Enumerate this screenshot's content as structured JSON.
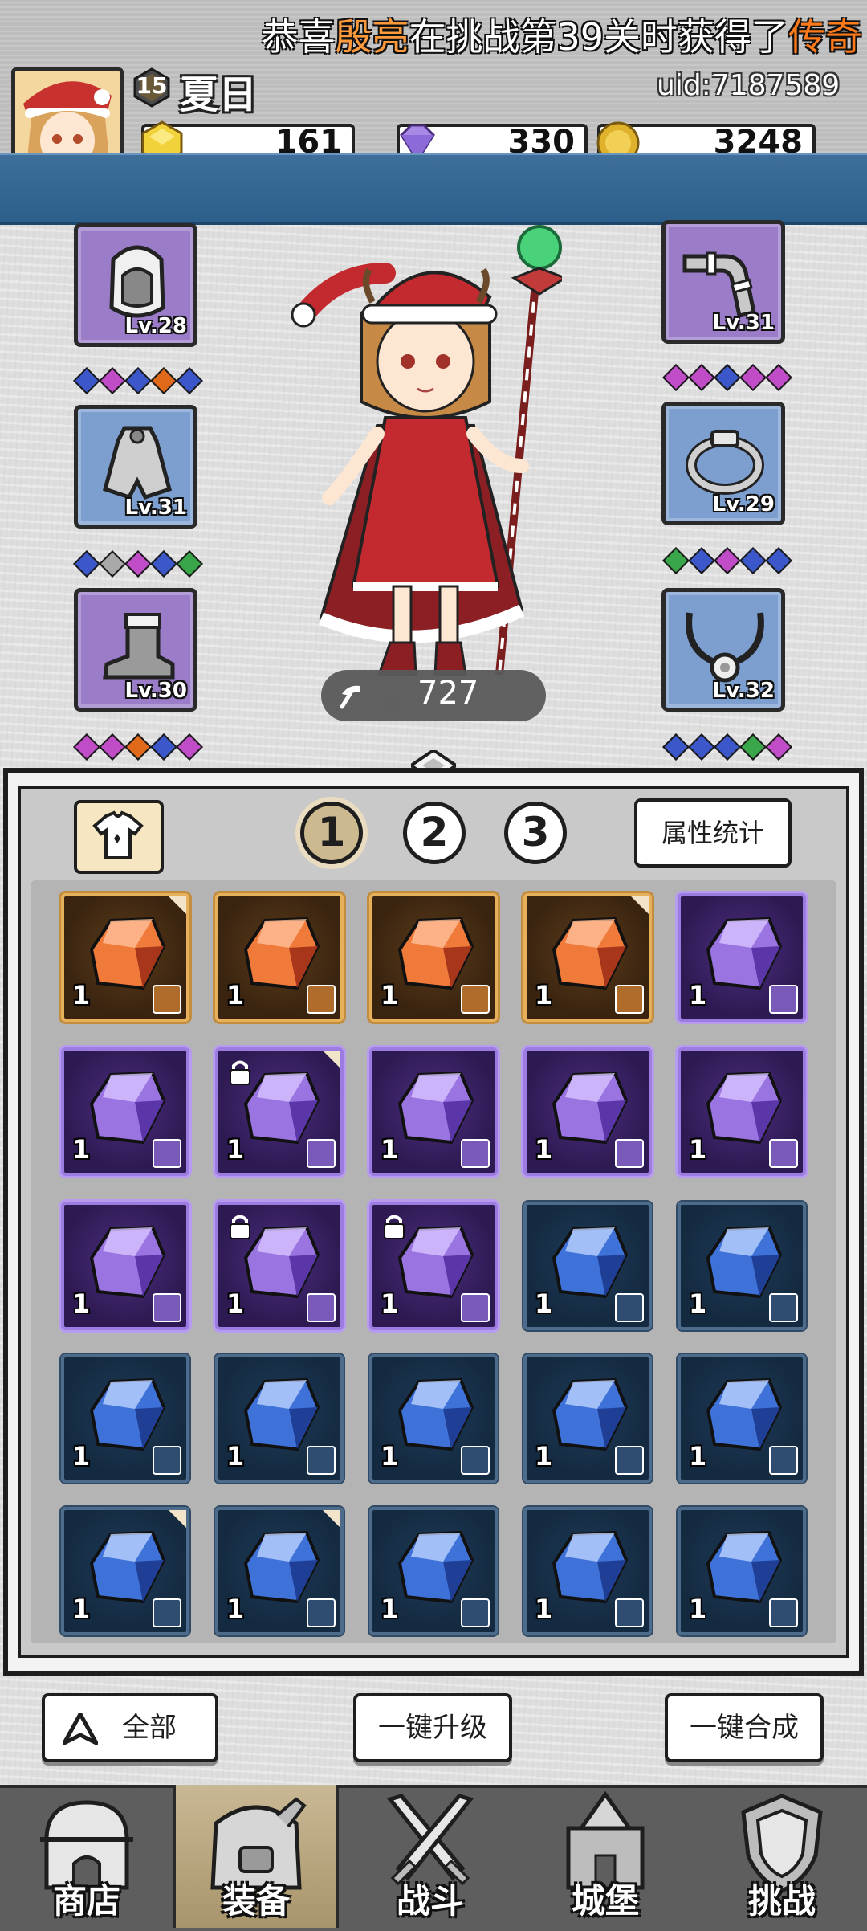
{
  "player": {
    "name": "夏日",
    "level": "15",
    "uid": "uid:7187589"
  },
  "resources": [
    {
      "name": "gold-gem",
      "value": "161",
      "color": "#f2d23a"
    },
    {
      "name": "purple-diamond",
      "value": "330",
      "color": "#a88ae6"
    },
    {
      "name": "gold-coin",
      "value": "3248",
      "color": "#e0b12a"
    }
  ],
  "announcement": {
    "prefix": "恭喜",
    "player": "殷亮",
    "middle": "在挑战第39关时获得了",
    "rarity": "传奇"
  },
  "equipment": {
    "left": [
      {
        "name": "helmet",
        "level": "Lv.28",
        "color": "purple",
        "gems": [
          "#3b57c9",
          "#c04cc8",
          "#3b57c9",
          "#e06a1a",
          "#3b57c9"
        ]
      },
      {
        "name": "cape",
        "level": "Lv.31",
        "color": "blue",
        "gems": [
          "#3b57c9",
          "#a9a9a9",
          "#c04cc8",
          "#3b57c9",
          "#3aa64a"
        ]
      },
      {
        "name": "boots",
        "level": "Lv.30",
        "color": "purple",
        "gems": [
          "#c04cc8",
          "#c04cc8",
          "#e06a1a",
          "#3b57c9",
          "#c04cc8"
        ]
      }
    ],
    "right": [
      {
        "name": "pipe-weapon",
        "level": "Lv.31",
        "color": "purple",
        "gems": [
          "#c04cc8",
          "#c04cc8",
          "#3b57c9",
          "#c04cc8",
          "#c04cc8"
        ]
      },
      {
        "name": "ring",
        "level": "Lv.29",
        "color": "blue",
        "gems": [
          "#3aa64a",
          "#3b57c9",
          "#c04cc8",
          "#3b57c9",
          "#3b57c9"
        ]
      },
      {
        "name": "necklace",
        "level": "Lv.32",
        "color": "blue",
        "gems": [
          "#3b57c9",
          "#3b57c9",
          "#3b57c9",
          "#3aa64a",
          "#c04cc8"
        ]
      }
    ]
  },
  "character": {
    "power": "727"
  },
  "inventory": {
    "tabs": [
      "1",
      "2",
      "3"
    ],
    "active_tab": 0,
    "stats_button": "属性统计",
    "items": [
      {
        "rarity": "orange",
        "qty": "1",
        "type": "ring",
        "corner": true,
        "lock": false
      },
      {
        "rarity": "orange",
        "qty": "1",
        "type": "cape",
        "corner": false,
        "lock": false
      },
      {
        "rarity": "orange",
        "qty": "1",
        "type": "weapon",
        "corner": false,
        "lock": false
      },
      {
        "rarity": "orange",
        "qty": "1",
        "type": "helmet",
        "corner": true,
        "lock": false
      },
      {
        "rarity": "purple",
        "qty": "1",
        "type": "boots",
        "corner": false,
        "lock": false
      },
      {
        "rarity": "purple",
        "qty": "1",
        "type": "weapon",
        "corner": false,
        "lock": false
      },
      {
        "rarity": "purple",
        "qty": "1",
        "type": "helmet",
        "corner": true,
        "lock": true
      },
      {
        "rarity": "purple",
        "qty": "1",
        "type": "helmet",
        "corner": false,
        "lock": false
      },
      {
        "rarity": "purple",
        "qty": "1",
        "type": "necklace",
        "corner": false,
        "lock": false
      },
      {
        "rarity": "purple",
        "qty": "1",
        "type": "necklace",
        "corner": false,
        "lock": false
      },
      {
        "rarity": "purple",
        "qty": "1",
        "type": "necklace",
        "corner": false,
        "lock": false
      },
      {
        "rarity": "purple",
        "qty": "1",
        "type": "necklace",
        "corner": false,
        "lock": true
      },
      {
        "rarity": "purple",
        "qty": "1",
        "type": "necklace",
        "corner": false,
        "lock": true
      },
      {
        "rarity": "blue",
        "qty": "1",
        "type": "ring",
        "corner": false,
        "lock": false
      },
      {
        "rarity": "blue",
        "qty": "1",
        "type": "ring",
        "corner": false,
        "lock": false
      },
      {
        "rarity": "blue",
        "qty": "1",
        "type": "ring",
        "corner": false,
        "lock": false
      },
      {
        "rarity": "blue",
        "qty": "1",
        "type": "ring",
        "corner": false,
        "lock": false
      },
      {
        "rarity": "blue",
        "qty": "1",
        "type": "cape",
        "corner": false,
        "lock": false
      },
      {
        "rarity": "blue",
        "qty": "1",
        "type": "cape",
        "corner": false,
        "lock": false
      },
      {
        "rarity": "blue",
        "qty": "1",
        "type": "cape",
        "corner": false,
        "lock": false
      },
      {
        "rarity": "blue",
        "qty": "1",
        "type": "boots",
        "corner": true,
        "lock": false
      },
      {
        "rarity": "blue",
        "qty": "1",
        "type": "boots",
        "corner": true,
        "lock": false
      },
      {
        "rarity": "blue",
        "qty": "1",
        "type": "boots",
        "corner": false,
        "lock": false
      },
      {
        "rarity": "blue",
        "qty": "1",
        "type": "weapon",
        "corner": false,
        "lock": false
      },
      {
        "rarity": "blue",
        "qty": "1",
        "type": "weapon",
        "corner": false,
        "lock": false
      }
    ]
  },
  "actions": {
    "filter_all": "全部",
    "upgrade_all": "一键升级",
    "merge_all": "一键合成"
  },
  "nav": [
    {
      "label": "商店",
      "icon": "shop-hut-icon",
      "active": false
    },
    {
      "label": "装备",
      "icon": "backpack-icon",
      "active": true
    },
    {
      "label": "战斗",
      "icon": "crossed-swords-icon",
      "active": false
    },
    {
      "label": "城堡",
      "icon": "castle-icon",
      "active": false
    },
    {
      "label": "挑战",
      "icon": "shield-emblem-icon",
      "active": false
    }
  ]
}
